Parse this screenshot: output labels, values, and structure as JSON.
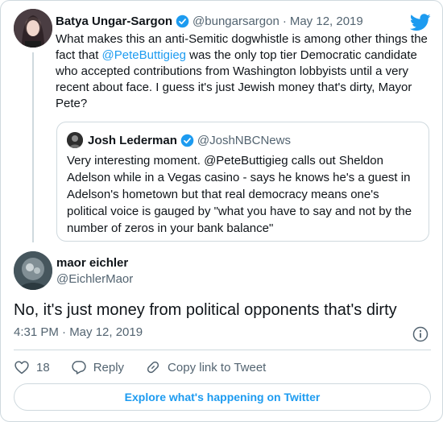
{
  "parent_tweet": {
    "author_name": "Batya Ungar-Sargon",
    "author_handle": "@bungarsargon",
    "separator": "·",
    "date": "May 12, 2019",
    "text_before_mention": "What makes this an anti-Semitic dogwhistle is among other things the fact that ",
    "mention": "@PeteButtigieg",
    "text_after_mention": " was the only top tier Democratic candidate who accepted contributions from Washington lobbyists until a very recent about face. I guess it's just Jewish money that's dirty, Mayor Pete?"
  },
  "quoted_tweet": {
    "author_name": "Josh Lederman",
    "author_handle": "@JoshNBCNews",
    "text": "Very interesting moment. @PeteButtigieg calls out Sheldon Adelson while in a Vegas casino - says he knows he's a guest in Adelson's hometown but that real democracy means one's political voice is gauged by \"what you have to say and not by the number of zeros in your bank balance\""
  },
  "main_tweet": {
    "author_name": "maor eichler",
    "author_handle": "@EichlerMaor",
    "text": "No, it's just money from political opponents that's dirty",
    "timestamp": "4:31 PM · May 12, 2019"
  },
  "actions": {
    "like_count": "18",
    "reply_label": "Reply",
    "copy_link_label": "Copy link to Tweet"
  },
  "explore_label": "Explore what's happening on Twitter",
  "colors": {
    "accent": "#1d9bf0",
    "secondary_text": "#536471",
    "border": "#cfd9de"
  },
  "icons": [
    "twitter-bird-icon",
    "verified-badge-icon",
    "info-icon",
    "heart-icon",
    "reply-icon",
    "link-icon"
  ]
}
